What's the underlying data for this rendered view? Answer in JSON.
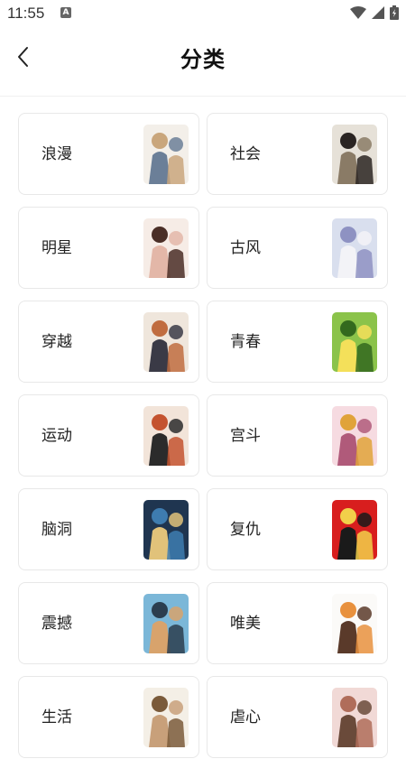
{
  "status_bar": {
    "time": "11:55",
    "notification_icon": "A"
  },
  "header": {
    "title": "分类",
    "back_icon": "chevron-left-icon"
  },
  "categories": [
    {
      "label": "浪漫",
      "colors": [
        "#f3efe9",
        "#c9a67c",
        "#6b7f98"
      ]
    },
    {
      "label": "社会",
      "colors": [
        "#e6e1d8",
        "#2a2422",
        "#8a7b66"
      ]
    },
    {
      "label": "明星",
      "colors": [
        "#f6ece6",
        "#4a2e26",
        "#e3b7a8"
      ]
    },
    {
      "label": "古风",
      "colors": [
        "#d9dfee",
        "#8e92c2",
        "#f3f3f7"
      ]
    },
    {
      "label": "穿越",
      "colors": [
        "#efe6dc",
        "#c06c3f",
        "#3a3a46"
      ]
    },
    {
      "label": "青春",
      "colors": [
        "#8bc34a",
        "#33691e",
        "#f4e05a"
      ]
    },
    {
      "label": "运动",
      "colors": [
        "#f2e4d9",
        "#c4532f",
        "#2b2b2b"
      ]
    },
    {
      "label": "宫斗",
      "colors": [
        "#f6dbe1",
        "#e0a33a",
        "#b05a7a"
      ]
    },
    {
      "label": "脑洞",
      "colors": [
        "#1f3550",
        "#3e7cb0",
        "#e1c27a"
      ]
    },
    {
      "label": "复仇",
      "colors": [
        "#d81e1e",
        "#f2d04a",
        "#1a1a1a"
      ]
    },
    {
      "label": "震撼",
      "colors": [
        "#7bb7d8",
        "#2b3e4f",
        "#d8a36c"
      ]
    },
    {
      "label": "唯美",
      "colors": [
        "#fbfaf8",
        "#e8913e",
        "#5a3a2a"
      ]
    },
    {
      "label": "生活",
      "colors": [
        "#f4efe6",
        "#7a5a3a",
        "#c8a07a"
      ]
    },
    {
      "label": "虐心",
      "colors": [
        "#f1d9d6",
        "#b06d5a",
        "#6a4a3a"
      ]
    }
  ]
}
